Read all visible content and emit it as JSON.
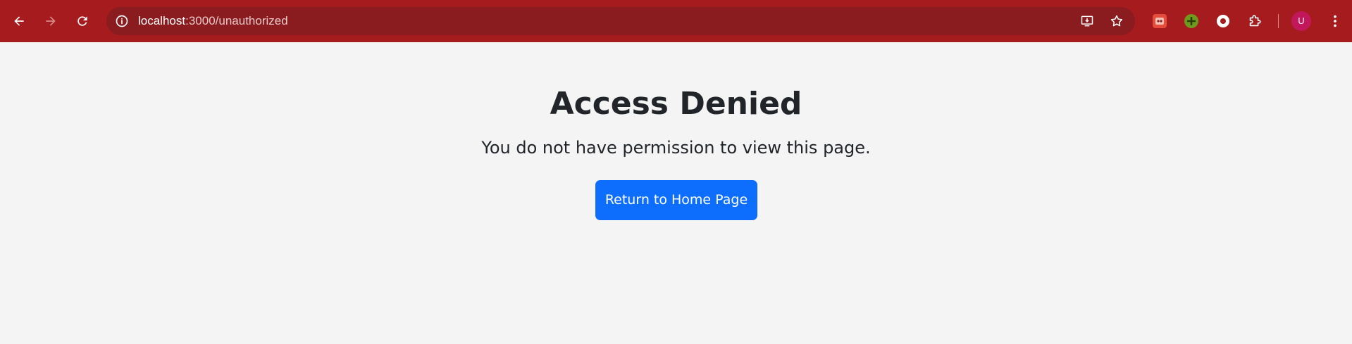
{
  "browser": {
    "url_host": "localhost",
    "url_path": ":3000/unauthorized",
    "toolbar_color": "#a51b1e",
    "omnibox_color": "#8a1c1f",
    "icons": [
      "back-icon",
      "forward-icon",
      "reload-icon",
      "site-info-icon",
      "install-app-icon",
      "bookmark-star-icon",
      "extension-icon",
      "extensions-puzzle-icon",
      "menu-icon"
    ],
    "profile_initial": "U",
    "profile_color": "#c2185b"
  },
  "page": {
    "title": "Access Denied",
    "message": "You do not have permission to view this page.",
    "button_label": "Return to Home Page",
    "button_color": "#0d6efd",
    "background": "#f4f4f5"
  }
}
